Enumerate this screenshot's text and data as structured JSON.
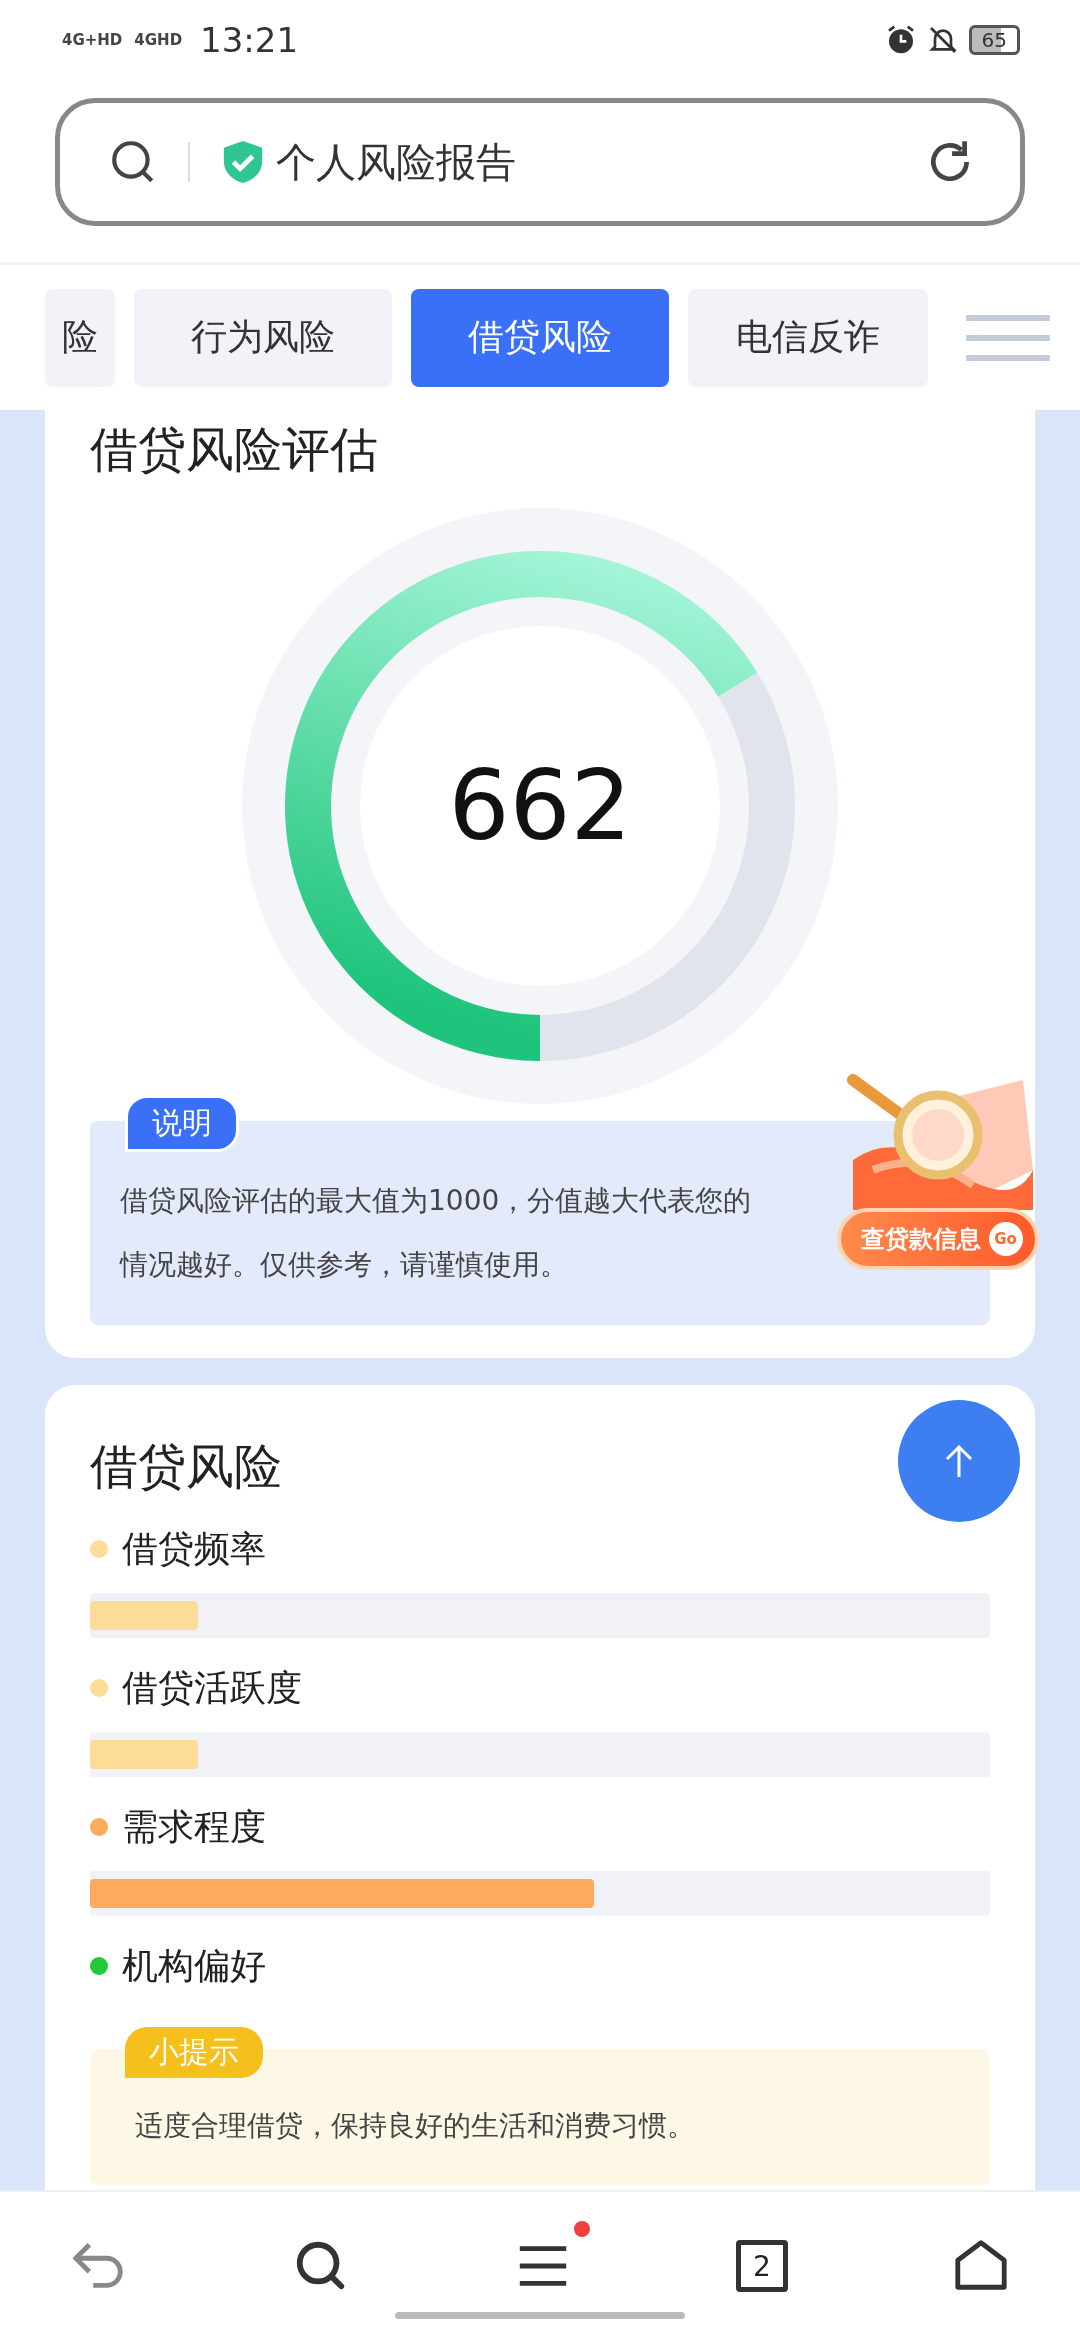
{
  "status_bar": {
    "network_1": "4G+HD",
    "network_2": "4GHD",
    "time": "13:21",
    "battery": "65"
  },
  "address_bar": {
    "title": "个人风险报告"
  },
  "tabs": [
    {
      "label": "险",
      "selected": false
    },
    {
      "label": "行为风险",
      "selected": false
    },
    {
      "label": "借贷风险",
      "selected": true
    },
    {
      "label": "电信反诈",
      "selected": false
    }
  ],
  "score_card": {
    "title": "借贷风险评估",
    "score": "662",
    "level": 0.662,
    "note": {
      "badge": "说明",
      "lines": [
        "借贷风险评估的最大值为1000，分值越大代表您的",
        "情况越好。仅供参考，请谨慎使用。"
      ]
    }
  },
  "promo": {
    "label": "查贷款信息",
    "go": "Go"
  },
  "risk_card": {
    "title": "借贷风险",
    "items": [
      {
        "label": "借贷频率",
        "color": "#fddc98",
        "level": 0.12
      },
      {
        "label": "借贷活跃度",
        "color": "#fddc98",
        "level": 0.12
      },
      {
        "label": "需求程度",
        "color": "#fdaa5d",
        "level": 0.56
      },
      {
        "label": "机构偏好",
        "color": "#22c93a"
      }
    ],
    "tip": {
      "badge": "小提示",
      "text": "适度合理借贷，保持良好的生活和消费习惯。"
    }
  },
  "bottom_nav": {
    "tab_count": "2",
    "menu_badge": true
  }
}
